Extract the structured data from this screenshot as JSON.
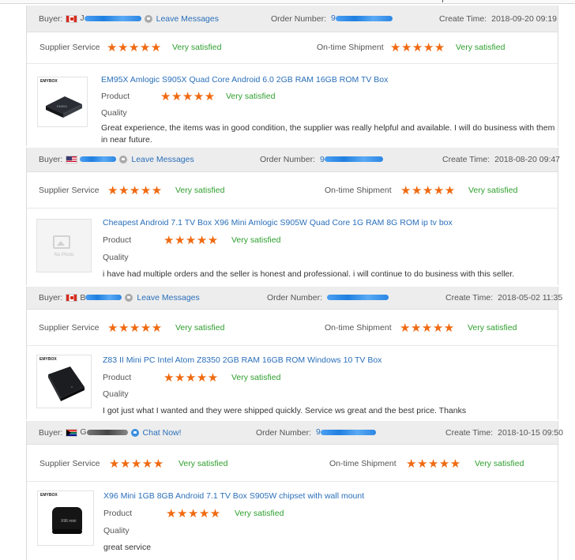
{
  "reviews": [
    {
      "buyer_label": "Buyer:",
      "buyer_name_visible": "J",
      "buyer_country": "Canada",
      "buyer_action": "Leave Messages",
      "order_label": "Order Number:",
      "order_number_visible": "9",
      "create_label": "Create Time:",
      "create_time": "2018-09-20 09:19",
      "supplier_service_label": "Supplier Service",
      "supplier_service_stars": 5,
      "supplier_service_text": "Very satisfied",
      "shipment_label": "On-time Shipment",
      "shipment_stars": 5,
      "shipment_text": "Very satisfied",
      "thumb_brand": "EMYBOX",
      "product_title": "EM95X Amlogic S905X Quad Core Android 6.0 2GB RAM 16GB ROM TV Box",
      "product_label": "Product",
      "product_stars": 5,
      "product_text": "Very satisfied",
      "quality_label": "Quality",
      "comment": "Great experience, the items was in good condition, the supplier was really helpful and available. I will do business with them in near future."
    },
    {
      "buyer_label": "Buyer:",
      "buyer_name_visible": "",
      "buyer_country": "United States",
      "buyer_action": "Leave Messages",
      "order_label": "Order Number:",
      "order_number_visible": "9",
      "create_label": "Create Time:",
      "create_time": "2018-08-20 09:47",
      "supplier_service_label": "Supplier Service",
      "supplier_service_stars": 5,
      "supplier_service_text": "Very satisfied",
      "shipment_label": "On-time Shipment",
      "shipment_stars": 5,
      "shipment_text": "Very satisfied",
      "no_photo_text": "No Photo",
      "product_title": "Cheapest Android 7.1 TV Box X96 Mini Amlogic S905W Quad Core 1G RAM 8G ROM ip tv box",
      "product_label": "Product",
      "product_stars": 5,
      "product_text": "Very satisfied",
      "quality_label": "Quality",
      "comment": "i have had multiple orders and the seller is honest and professional. i will continue to do business with this seller."
    },
    {
      "buyer_label": "Buyer:",
      "buyer_name_visible": "B",
      "buyer_country": "Canada",
      "buyer_action": "Leave Messages",
      "order_label": "Order Number:",
      "order_number_visible": "",
      "create_label": "Create Time:",
      "create_time": "2018-05-02 11:35",
      "supplier_service_label": "Supplier Service",
      "supplier_service_stars": 5,
      "supplier_service_text": "Very satisfied",
      "shipment_label": "On-time Shipment",
      "shipment_stars": 5,
      "shipment_text": "Very satisfied",
      "thumb_brand": "EMYBOX",
      "product_title": "Z83 II Mini PC Intel Atom Z8350 2GB RAM 16GB ROM Windows 10 TV Box",
      "product_label": "Product",
      "product_stars": 5,
      "product_text": "Very satisfied",
      "quality_label": "Quality",
      "comment": "I got just what I wanted and they were shipped quickly. Service ws great and the best price. Thanks"
    },
    {
      "buyer_label": "Buyer:",
      "buyer_name_visible": "G",
      "buyer_country": "South Africa",
      "buyer_action": "Chat Now!",
      "order_label": "Order Number:",
      "order_number_visible": "9",
      "create_label": "Create Time:",
      "create_time": "2018-10-15 09:50",
      "supplier_service_label": "Supplier Service",
      "supplier_service_stars": 5,
      "supplier_service_text": "Very satisfied",
      "shipment_label": "On-time Shipment",
      "shipment_stars": 5,
      "shipment_text": "Very satisfied",
      "thumb_brand": "EMYBOX",
      "product_title": "X96 Mini 1GB 8GB Android 7.1 TV Box S905W chipset with wall mount",
      "product_label": "Product",
      "product_stars": 5,
      "product_text": "Very satisfied",
      "quality_label": "Quality",
      "comment": "great service"
    }
  ],
  "icons": {
    "star": "★",
    "flags": {
      "Canada": "flag-canada-icon",
      "United States": "flag-usa-icon",
      "South Africa": "flag-south-africa-icon"
    }
  },
  "colors": {
    "star": "#f06a11",
    "satisfied_green": "#2e9e2e",
    "link_blue": "#2a6fba",
    "header_gray": "#ededed"
  }
}
